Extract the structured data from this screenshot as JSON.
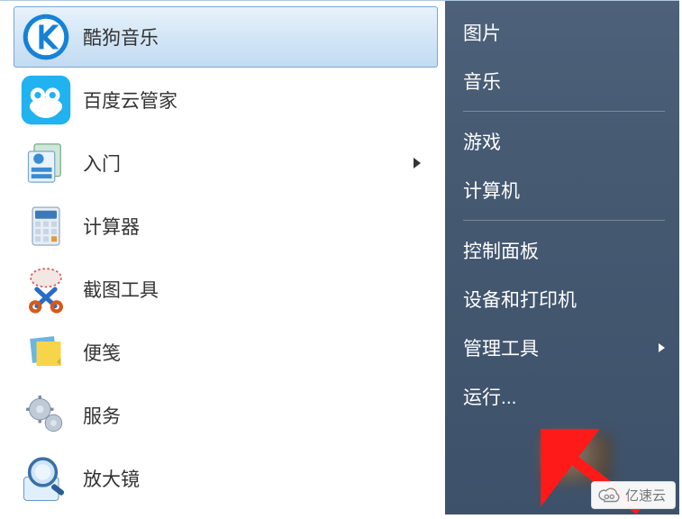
{
  "left_panel": {
    "items": [
      {
        "id": "kugou",
        "label": "酷狗音乐",
        "selected": true
      },
      {
        "id": "baiducloud",
        "label": "百度云管家"
      },
      {
        "id": "gettingstarted",
        "label": "入门",
        "has_submenu": true
      },
      {
        "id": "calculator",
        "label": "计算器"
      },
      {
        "id": "snipping",
        "label": "截图工具"
      },
      {
        "id": "stickynotes",
        "label": "便笺"
      },
      {
        "id": "services",
        "label": "服务"
      },
      {
        "id": "magnifier",
        "label": "放大镜"
      }
    ]
  },
  "right_panel": {
    "items": [
      {
        "id": "pictures",
        "label": "图片"
      },
      {
        "id": "music",
        "label": "音乐",
        "divider_after": true
      },
      {
        "id": "games",
        "label": "游戏"
      },
      {
        "id": "computer",
        "label": "计算机",
        "divider_after": true
      },
      {
        "id": "controlpanel",
        "label": "控制面板"
      },
      {
        "id": "devices",
        "label": "设备和打印机"
      },
      {
        "id": "admintools",
        "label": "管理工具",
        "has_submenu": true
      },
      {
        "id": "run",
        "label": "运行..."
      }
    ]
  },
  "watermark": {
    "text": "亿速云"
  }
}
